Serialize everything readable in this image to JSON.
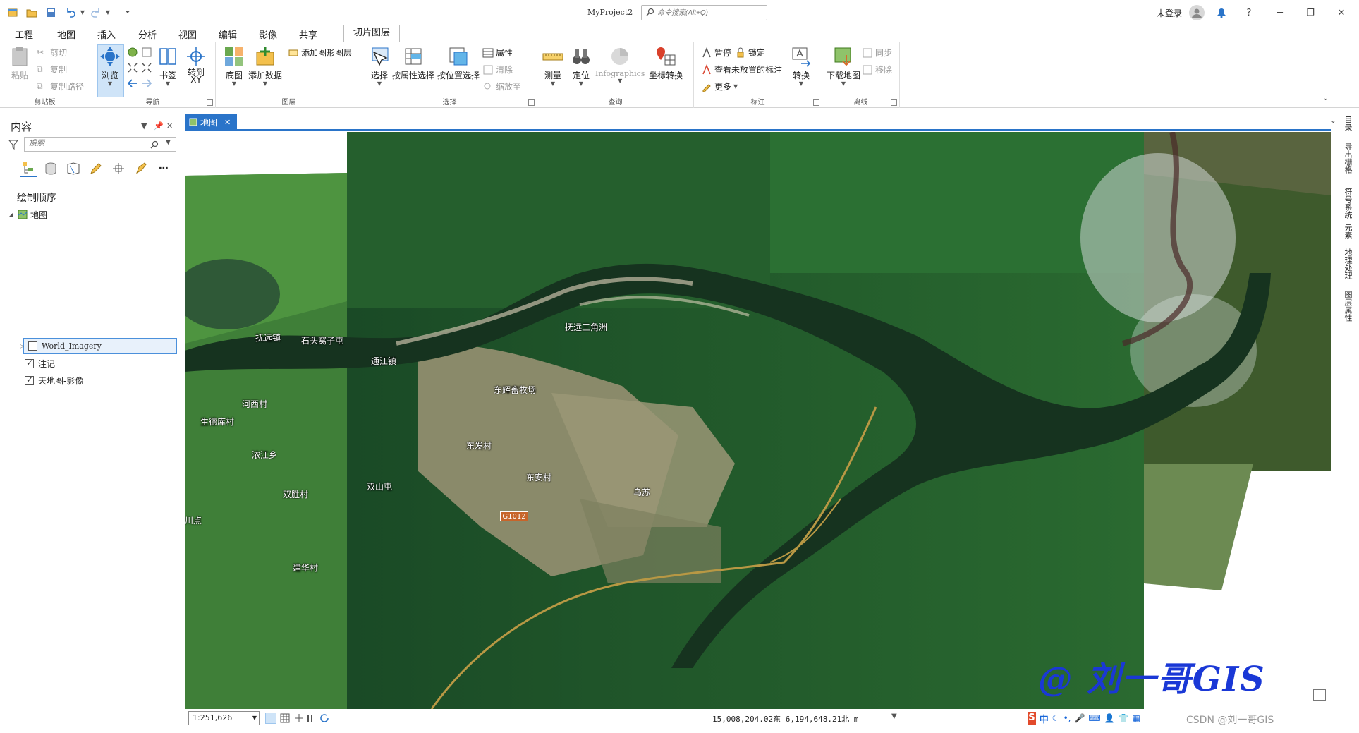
{
  "app": {
    "title": "MyProject2",
    "command_search_placeholder": "命令搜索(Alt+Q)",
    "login_label": "未登录",
    "help_label": "?"
  },
  "tabs": [
    "工程",
    "地图",
    "插入",
    "分析",
    "视图",
    "编辑",
    "影像",
    "共享"
  ],
  "active_tab": "地图",
  "contextual_tab": "切片图层",
  "ribbon": {
    "clipboard": {
      "label": "剪贴板",
      "paste": "粘贴",
      "cut": "剪切",
      "copy": "复制",
      "copy_path": "复制路径"
    },
    "navigate": {
      "label": "导航",
      "explore": "浏览",
      "bookmarks": "书签",
      "goto_xy": "转到\nXY"
    },
    "layer": {
      "label": "图层",
      "basemap": "底图",
      "add_data": "添加数据",
      "add_graphics": "添加图形图层"
    },
    "selection": {
      "label": "选择",
      "select": "选择",
      "by_attr": "按属性选择",
      "by_loc": "按位置选择",
      "attributes": "属性",
      "clear": "清除",
      "zoom_to": "缩放至"
    },
    "inquiry": {
      "label": "查询",
      "measure": "测量",
      "locate": "定位",
      "infographics": "Infographics",
      "coord_convert": "坐标转换"
    },
    "labeling": {
      "label": "标注",
      "pause": "暂停",
      "lock": "锁定",
      "unplaced": "查看未放置的标注",
      "more": "更多",
      "convert": "转换"
    },
    "offline": {
      "label": "离线",
      "download": "下载地图",
      "sync": "同步",
      "remove": "移除"
    }
  },
  "contents": {
    "title": "内容",
    "search_placeholder": "搜索",
    "drawing_order": "绘制顺序",
    "map_node": "地图",
    "layers": [
      {
        "name": "World_Imagery",
        "checked": false,
        "selected": true
      },
      {
        "name": "注记",
        "checked": true,
        "selected": false
      },
      {
        "name": "天地图-影像",
        "checked": true,
        "selected": false
      }
    ]
  },
  "map_tab": "地图",
  "map": {
    "places": [
      "抚远镇",
      "石头窝子屯",
      "通江镇",
      "抚远三角洲",
      "东辉畜牧场",
      "河西村",
      "生德库村",
      "浓江乡",
      "东发村",
      "东安村",
      "双胜村",
      "双山屯",
      "乌苏",
      "川点",
      "建华村"
    ],
    "road_shield": "G1012",
    "watermark": "@ 刘一哥GIS"
  },
  "right_dock": [
    "目录",
    "导出栅格",
    "符号系统",
    "元素",
    "地理处理",
    "图层属性"
  ],
  "status": {
    "scale": "1:251,626",
    "coordinates": "15,008,204.02东 6,194,648.21北 m",
    "ime_label": "中",
    "credit": "CSDN @刘一哥GIS"
  },
  "colors": {
    "accent": "#2a74c9",
    "watermark": "#1a38d6"
  }
}
